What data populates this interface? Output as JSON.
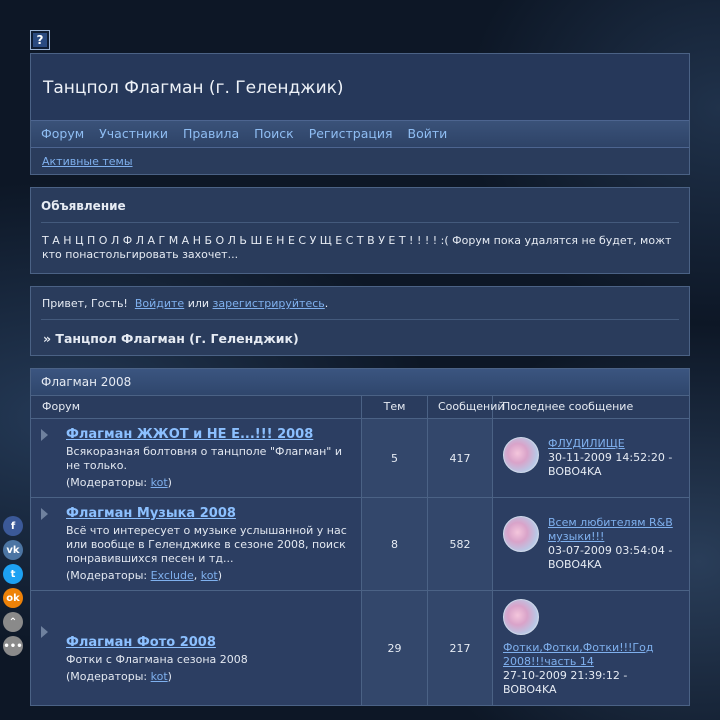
{
  "help_icon": "?",
  "header": {
    "title": "Танцпол Флагман (г. Геленджик)",
    "nav": [
      "Форум",
      "Участники",
      "Правила",
      "Поиск",
      "Регистрация",
      "Войти"
    ],
    "subnav": "Активные темы"
  },
  "announcement": {
    "title": "Объявление",
    "text": "Т А Н Ц П О Л Ф Л А Г М А Н Б О Л Ь Ш Е Н Е С У Щ Е С Т В У Е Т ! ! ! ! :( Форум пока удалятся не будет, можт кто понастольгировать захочет..."
  },
  "greeting": {
    "prefix": "Привет, Гость!",
    "login": "Войдите",
    "or": "или",
    "register": "зарегистрируйтесь",
    "dot": ".",
    "breadcrumb": "» Танцпол Флагман (г. Геленджик)"
  },
  "category": {
    "title": "Флагман 2008",
    "columns": [
      "Форум",
      "Тем",
      "Сообщений",
      "Последнее сообщение"
    ],
    "moderators_label": "(Модераторы:",
    "forums": [
      {
        "name": "Флагман ЖЖОТ и НЕ Е...!!! 2008",
        "desc": "Всякоразная болтовня о танцполе \"Флагман\" и не только.",
        "mods": [
          "kot"
        ],
        "topics": "5",
        "posts": "417",
        "last_title": "ФЛУДИЛИЩЕ",
        "last_meta": "30-11-2009 14:52:20 - BOBO4KA"
      },
      {
        "name": "Флагман Музыка 2008",
        "desc": "Всё что интересует о музыке услышанной у нас или вообще в Геленджике в сезоне 2008, поиск понравившихся песен и тд...",
        "mods": [
          "Exclude",
          "kot"
        ],
        "topics": "8",
        "posts": "582",
        "last_title": "Всем любителям R&B музыки!!!",
        "last_meta": "03-07-2009 03:54:04 - BOBO4KA"
      },
      {
        "name": "Флагман Фото 2008",
        "desc": "Фотки с Флагмана сезона 2008",
        "mods": [
          "kot"
        ],
        "topics": "29",
        "posts": "217",
        "last_title": "Фотки,Фотки,Фотки!!!Год 2008!!!часть 14",
        "last_meta": "27-10-2009 21:39:12 - BOBO4KA"
      }
    ]
  },
  "social": [
    {
      "icon": "facebook-icon",
      "glyph": "f",
      "color": "#3b5998"
    },
    {
      "icon": "vk-icon",
      "glyph": "vk",
      "color": "#4c75a3"
    },
    {
      "icon": "twitter-icon",
      "glyph": "t",
      "color": "#1da1f2"
    },
    {
      "icon": "odnoklassniki-icon",
      "glyph": "ok",
      "color": "#ee8208"
    },
    {
      "icon": "collapse-icon",
      "glyph": "⌃",
      "color": "#8a8a8a"
    },
    {
      "icon": "more-icon",
      "glyph": "•••",
      "color": "#8a8a8a"
    }
  ]
}
